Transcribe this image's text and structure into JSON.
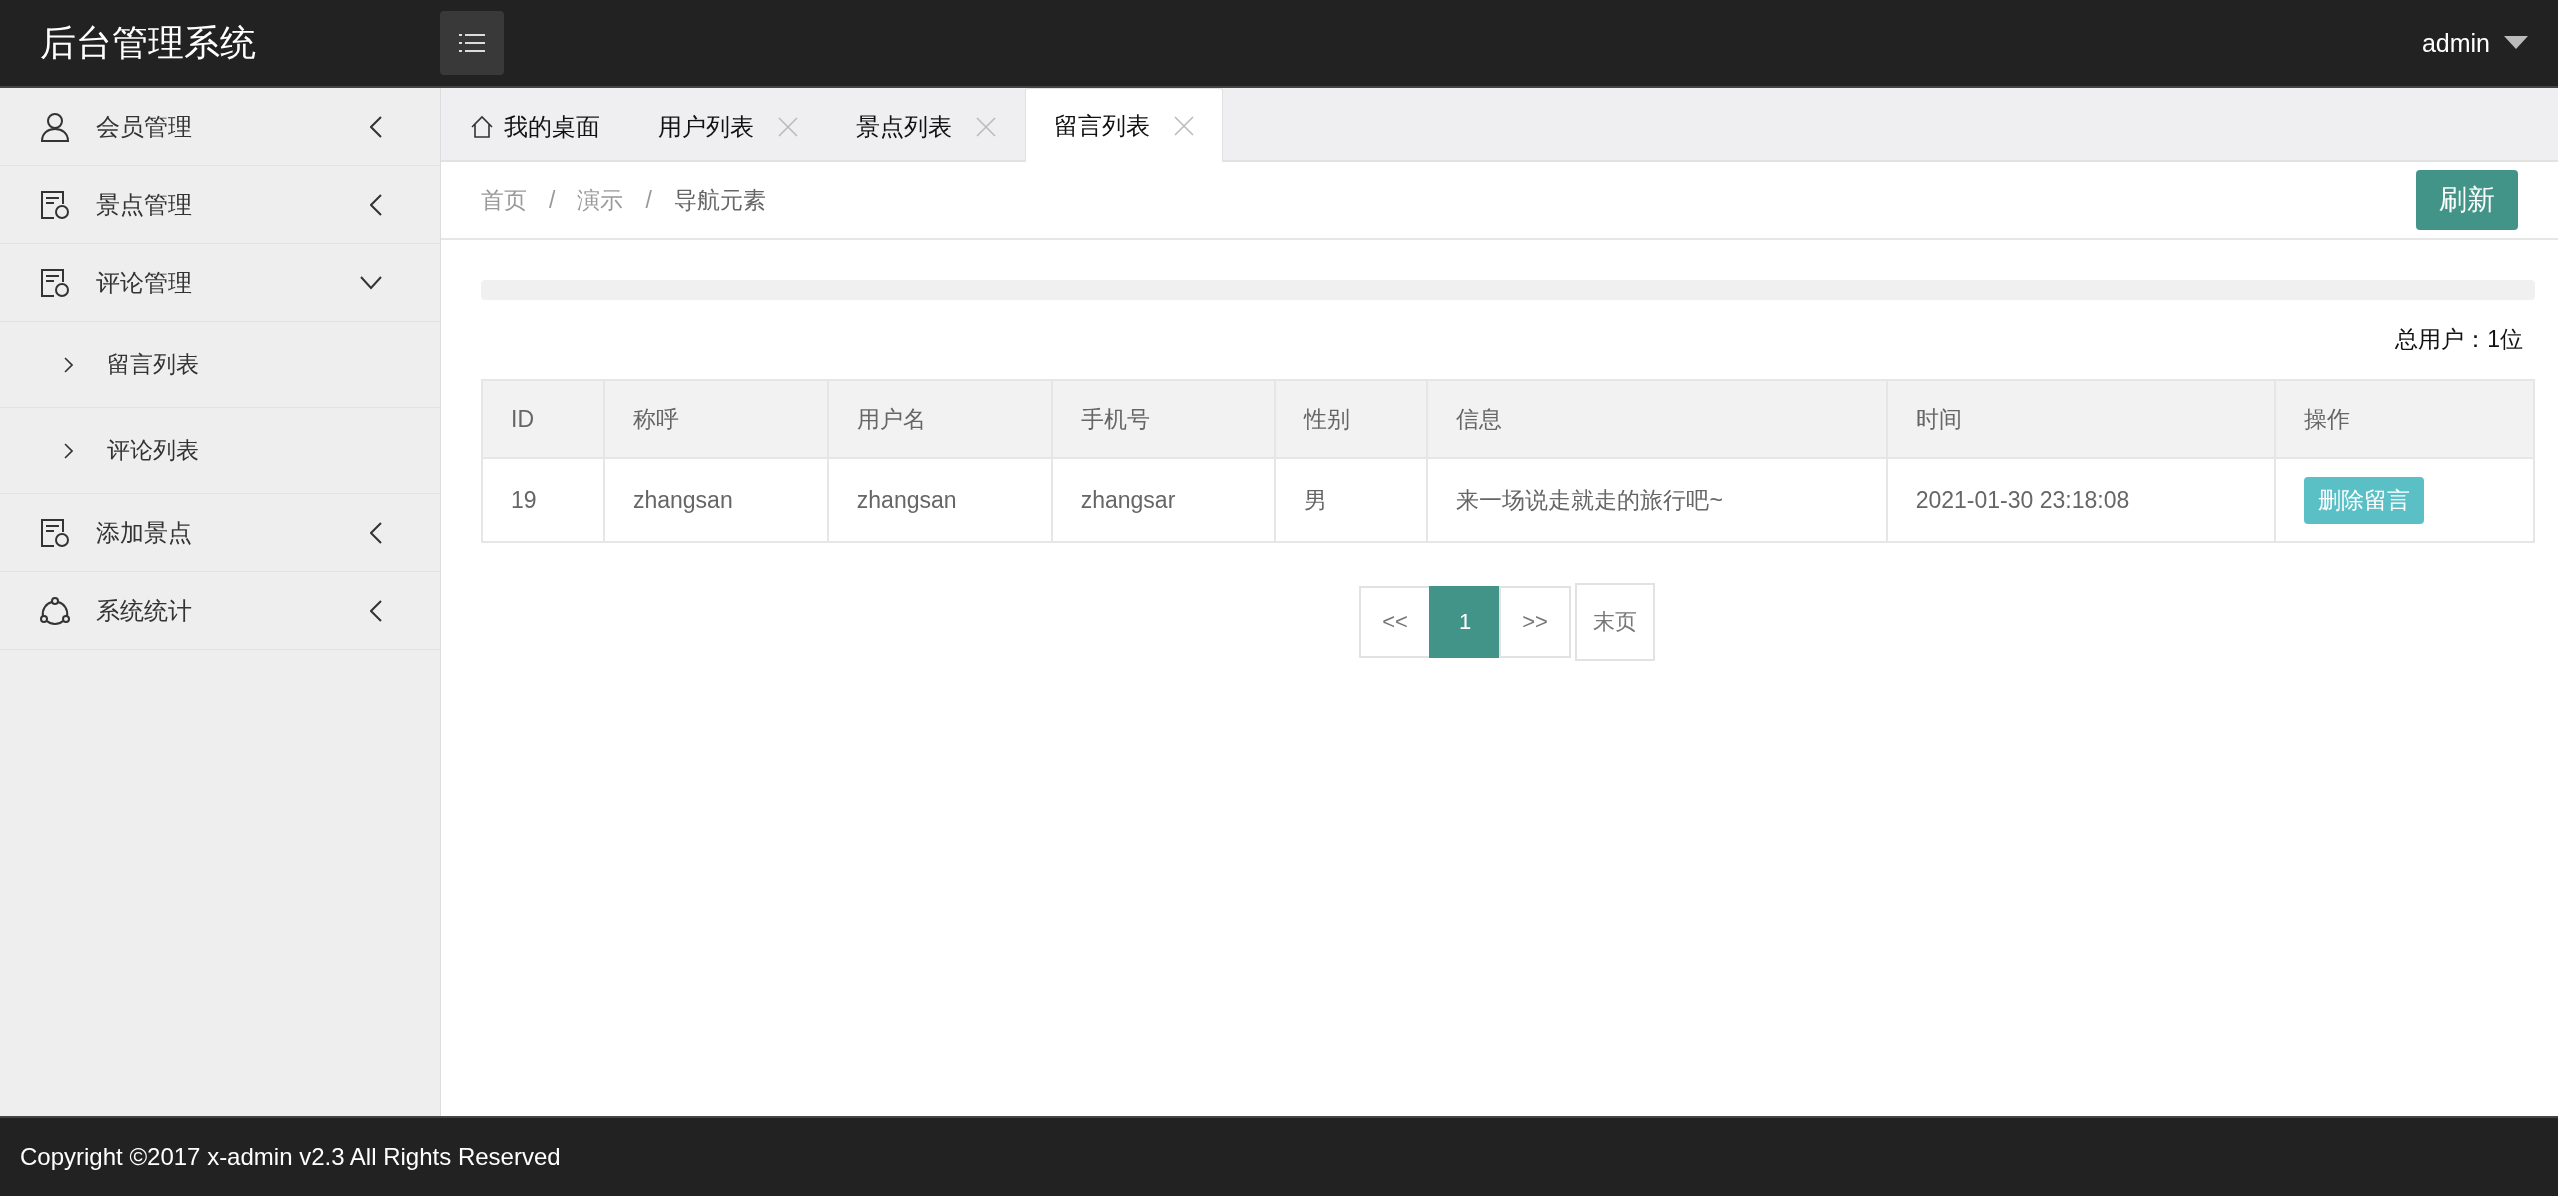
{
  "header": {
    "title": "后台管理系统",
    "user": "admin"
  },
  "sidebar": {
    "items": [
      {
        "label": "会员管理",
        "expanded": false
      },
      {
        "label": "景点管理",
        "expanded": false
      },
      {
        "label": "评论管理",
        "expanded": true,
        "children": [
          {
            "label": "留言列表"
          },
          {
            "label": "评论列表"
          }
        ]
      },
      {
        "label": "添加景点",
        "expanded": false
      },
      {
        "label": "系统统计",
        "expanded": false
      }
    ]
  },
  "tabs": [
    {
      "label": "我的桌面",
      "kind": "home",
      "selected": false
    },
    {
      "label": "用户列表",
      "kind": "page",
      "selected": false
    },
    {
      "label": "景点列表",
      "kind": "page",
      "selected": false
    },
    {
      "label": "留言列表",
      "kind": "page",
      "selected": true
    }
  ],
  "breadcrumb": [
    {
      "label": "首页",
      "separator": "/"
    },
    {
      "label": "演示",
      "separator": "/"
    },
    {
      "label": "导航元素"
    }
  ],
  "refresh_button": "刷新",
  "progress": {
    "level": 0
  },
  "total_users": "总用户：1位",
  "table": {
    "columns": [
      "ID",
      "称呼",
      "用户名",
      "手机号",
      "性别",
      "信息",
      "时间",
      "操作"
    ],
    "rows": [
      {
        "cells": [
          "19",
          "zhangsan",
          "zhangsan",
          "zhangsar",
          "男",
          "来一场说走就走的旅行吧~",
          "2021-01-30 23:18:08"
        ],
        "action": "删除留言"
      }
    ]
  },
  "pagination": [
    {
      "label": "<<",
      "selected": false
    },
    {
      "label": "1",
      "selected": true
    },
    {
      "label": ">>",
      "selected": false
    },
    {
      "label": "末页",
      "selected": false
    }
  ],
  "footer": "Copyright ©2017 x-admin v2.3 All Rights Reserved"
}
